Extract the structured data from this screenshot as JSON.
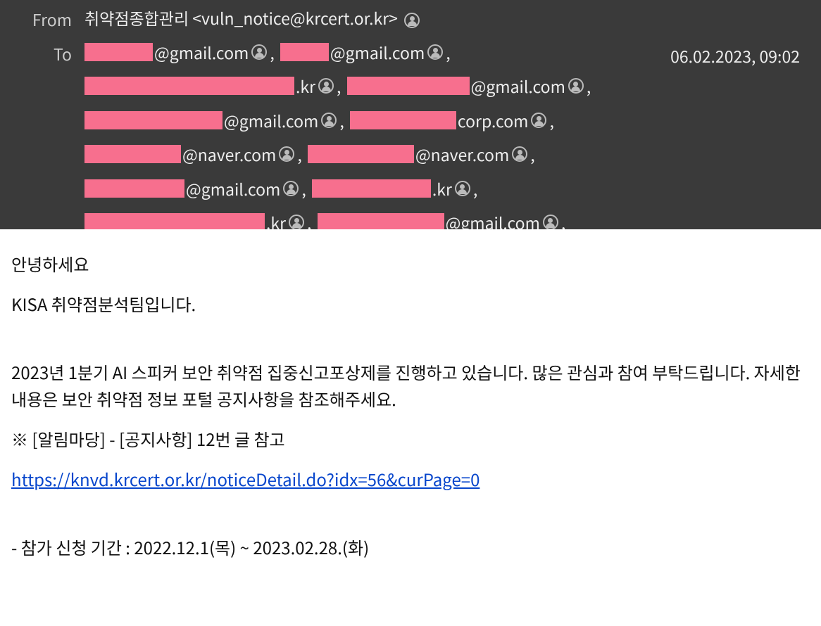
{
  "header": {
    "from_label": "From",
    "to_label": "To",
    "from_value": "취약점종합관리 <vuln_notice@krcert.or.kr>",
    "timestamp": "06.02.2023, 09:02",
    "recipients": [
      [
        {
          "redact_w": 97,
          "suffix": "@gmail.com"
        },
        {
          "redact_w": 69,
          "suffix": "@gmail.com",
          "trailing": ","
        }
      ],
      [
        {
          "redact_w": 298,
          "suffix": ".kr"
        },
        {
          "redact_w": 174,
          "suffix": "@gmail.com",
          "trailing": ","
        }
      ],
      [
        {
          "redact_w": 196,
          "suffix": "@gmail.com"
        },
        {
          "redact_w": 151,
          "suffix": "corp.com",
          "trailing": ","
        }
      ],
      [
        {
          "redact_w": 137,
          "suffix": "@naver.com"
        },
        {
          "redact_w": 151,
          "suffix": "@naver.com",
          "trailing": ","
        }
      ],
      [
        {
          "redact_w": 142,
          "suffix": "@gmail.com"
        },
        {
          "redact_w": 169,
          "suffix": ".kr",
          "trailing": ","
        }
      ],
      [
        {
          "redact_w": 256,
          "suffix": ".kr"
        },
        {
          "redact_w": 180,
          "suffix": "@gmail.com",
          "trailing": ","
        }
      ]
    ]
  },
  "body": {
    "greeting": "안녕하세요",
    "intro": "KISA 취약점분석팀입니다.",
    "para1": "2023년 1분기 AI 스피커 보안 취약점 집중신고포상제를 진행하고 있습니다. 많은 관심과 참여 부탁드립니다. 자세한 내용은 보안 취약점 정보 포털 공지사항을 참조해주세요.",
    "note": "※ [알림마당] - [공지사항] 12번 글 참고",
    "link_text": "https://knvd.krcert.or.kr/noticeDetail.do?idx=56&curPage=0",
    "period": "- 참가 신청 기간 : 2022.12.1(목) ~ 2023.02.28.(화)"
  }
}
